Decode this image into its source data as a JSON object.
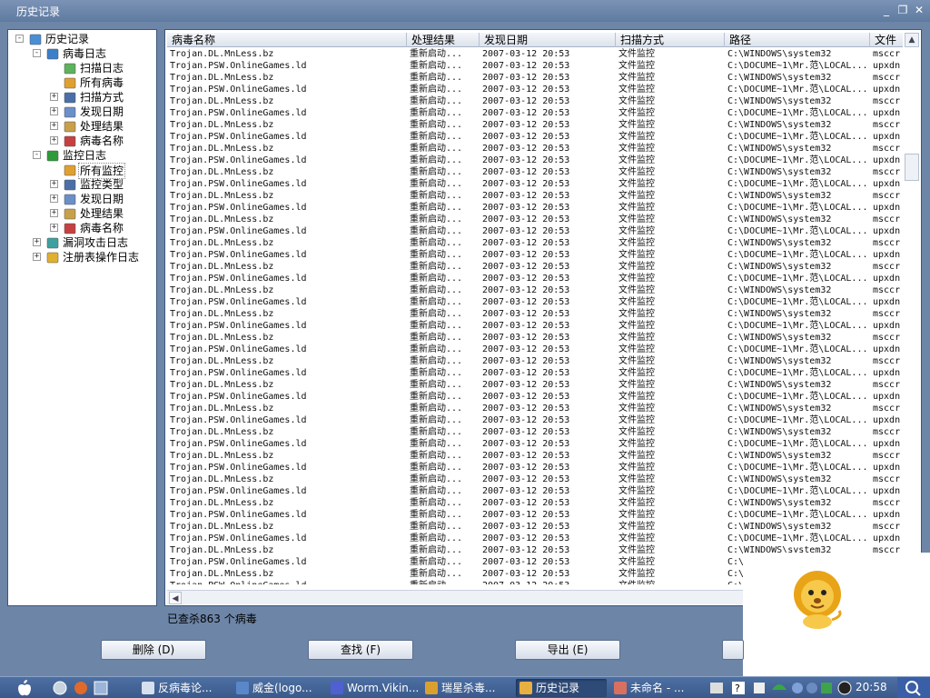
{
  "window": {
    "title": "历史记录"
  },
  "tree": {
    "items": [
      {
        "label": "历史记录",
        "level": 0,
        "expander": "−",
        "icon": "history-icon"
      },
      {
        "label": "病毒日志",
        "level": 1,
        "expander": "−",
        "icon": "virus-log-icon"
      },
      {
        "label": "扫描日志",
        "level": 2,
        "expander": "",
        "icon": "scan-log-icon"
      },
      {
        "label": "所有病毒",
        "level": 2,
        "expander": "",
        "icon": "all-virus-icon"
      },
      {
        "label": "扫描方式",
        "level": 2,
        "expander": "+",
        "icon": "scan-method-icon"
      },
      {
        "label": "发现日期",
        "level": 2,
        "expander": "+",
        "icon": "date-icon"
      },
      {
        "label": "处理结果",
        "level": 2,
        "expander": "+",
        "icon": "result-icon"
      },
      {
        "label": "病毒名称",
        "level": 2,
        "expander": "+",
        "icon": "virus-name-icon"
      },
      {
        "label": "监控日志",
        "level": 1,
        "expander": "−",
        "icon": "monitor-log-icon"
      },
      {
        "label": "所有监控",
        "level": 2,
        "expander": "",
        "icon": "all-monitor-icon"
      },
      {
        "label": "监控类型",
        "level": 2,
        "expander": "+",
        "icon": "monitor-type-icon"
      },
      {
        "label": "发现日期",
        "level": 2,
        "expander": "+",
        "icon": "date-icon"
      },
      {
        "label": "处理结果",
        "level": 2,
        "expander": "+",
        "icon": "result-icon"
      },
      {
        "label": "病毒名称",
        "level": 2,
        "expander": "+",
        "icon": "virus-name-icon"
      },
      {
        "label": "漏洞攻击日志",
        "level": 1,
        "expander": "+",
        "icon": "vuln-log-icon"
      },
      {
        "label": "注册表操作日志",
        "level": 1,
        "expander": "+",
        "icon": "registry-log-icon"
      }
    ]
  },
  "table": {
    "columns": [
      "病毒名称",
      "处理结果",
      "发现日期",
      "扫描方式",
      "路径",
      "文件"
    ],
    "row_variants": [
      [
        "Trojan.DL.MnLess.bz",
        "重新启动...",
        "2007-03-12 20:53",
        "文件监控",
        "C:\\WINDOWS\\system32",
        "msccr"
      ],
      [
        "Trojan.PSW.OnlineGames.ld",
        "重新启动...",
        "2007-03-12 20:53",
        "文件监控",
        "C:\\DOCUME~1\\Mr.范\\LOCAL...",
        "upxdn"
      ]
    ],
    "visible_rows": 46,
    "last_row_name": "Trojan.DL.MnLess.bz"
  },
  "status": {
    "found_text": "已查杀863 个病毒"
  },
  "buttons": {
    "delete": "删除 (D)",
    "find": "查找 (F)",
    "export": "导出 (E)"
  },
  "taskbar": {
    "items": [
      {
        "label": "反病毒论...",
        "active": false
      },
      {
        "label": "威金(logo...",
        "active": false
      },
      {
        "label": "Worm.Vikin...",
        "active": false
      },
      {
        "label": "瑞星杀毒...",
        "active": false
      },
      {
        "label": "历史记录",
        "active": true
      },
      {
        "label": "未命名 - ...",
        "active": false
      }
    ],
    "clock": "20:58"
  }
}
